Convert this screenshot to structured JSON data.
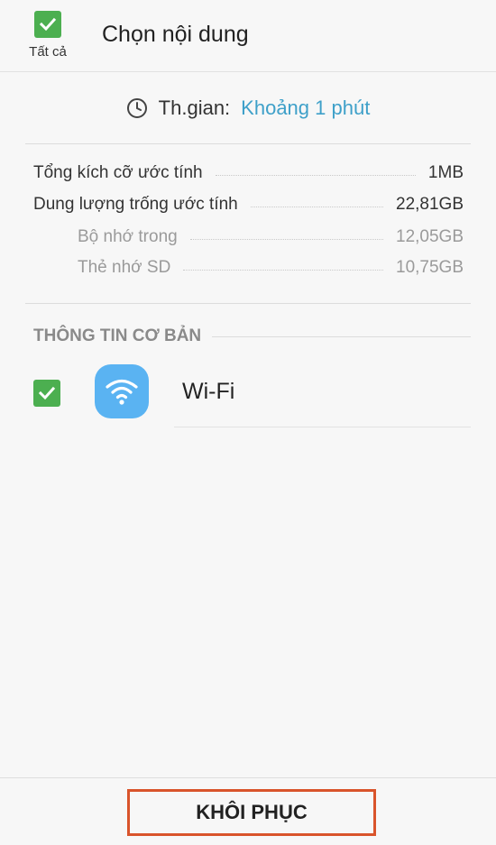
{
  "header": {
    "select_all_label": "Tất cả",
    "title": "Chọn nội dung"
  },
  "time": {
    "icon": "clock-icon",
    "label": "Th.gian:",
    "value": "Khoảng 1 phút"
  },
  "sizes": [
    {
      "label": "Tổng kích cỡ ước tính",
      "value": "1MB"
    },
    {
      "label": "Dung lượng trống ước tính",
      "value": "22,81GB"
    },
    {
      "label": "Bộ nhớ trong",
      "value": "12,05GB"
    },
    {
      "label": "Thẻ nhớ SD",
      "value": "10,75GB"
    }
  ],
  "section": {
    "title": "THÔNG TIN CƠ BẢN",
    "items": [
      {
        "label": "Wi-Fi",
        "icon": "wifi-icon",
        "checked": true
      }
    ]
  },
  "footer": {
    "restore_label": "KHÔI PHỤC"
  },
  "colors": {
    "checkbox": "#4caf50",
    "accent": "#3ea0c9",
    "wifi_icon_bg": "#5ab3f2",
    "highlight_border": "#d9542b"
  }
}
